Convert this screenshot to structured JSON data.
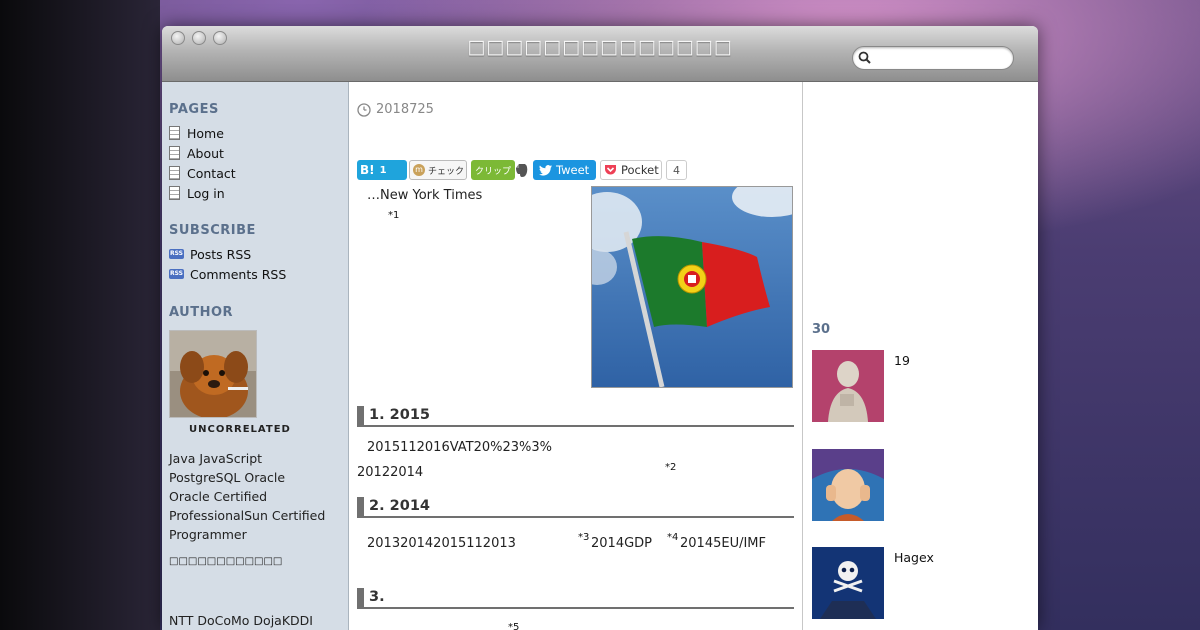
{
  "site": {
    "title": "□□□□□□□□□□□□□□",
    "search_placeholder": ""
  },
  "sidebar": {
    "pages_heading": "PAGES",
    "pages": [
      "Home",
      "About",
      "Contact",
      "Log in"
    ],
    "subscribe_heading": "SUBSCRIBE",
    "subscribe": [
      "Posts RSS",
      "Comments RSS"
    ],
    "author_heading": "AUTHOR",
    "author_name": "UNCORRELATED",
    "bio_lines": [
      "Java JavaScript",
      "PostgreSQL Oracle",
      "Oracle Certified",
      "ProfessionalSun Certified",
      "Programmer"
    ],
    "bio_note": "□□□□□□□□□□□□",
    "bio_bottom": "NTT DoCoMo DojaKDDI"
  },
  "post": {
    "date": "2018725",
    "share": {
      "hatena_label": "B!",
      "hatena_count": "1",
      "mixi_label": "チェック",
      "clip_label": "クリップ",
      "tweet_label": "Tweet",
      "pocket_label": "Pocket",
      "pocket_count": "4"
    },
    "intro": "…New York Times",
    "fn1": "*1",
    "sections": [
      {
        "heading": "1. 2015",
        "line1": "2015112016VAT20%23%3%",
        "line2": "20122014",
        "fn": "*2"
      },
      {
        "heading": "2. 2014",
        "part1": "201320142015112013",
        "fn3": "*3",
        "part2": "2014GDP",
        "fn4": "*4",
        "part3": "20145EU/IMF"
      },
      {
        "heading": "3.",
        "fn5": "*5"
      }
    ]
  },
  "rightbar": {
    "heading": "30",
    "items": [
      {
        "label": "19"
      },
      {
        "label": ""
      },
      {
        "label": "Hagex"
      }
    ]
  }
}
